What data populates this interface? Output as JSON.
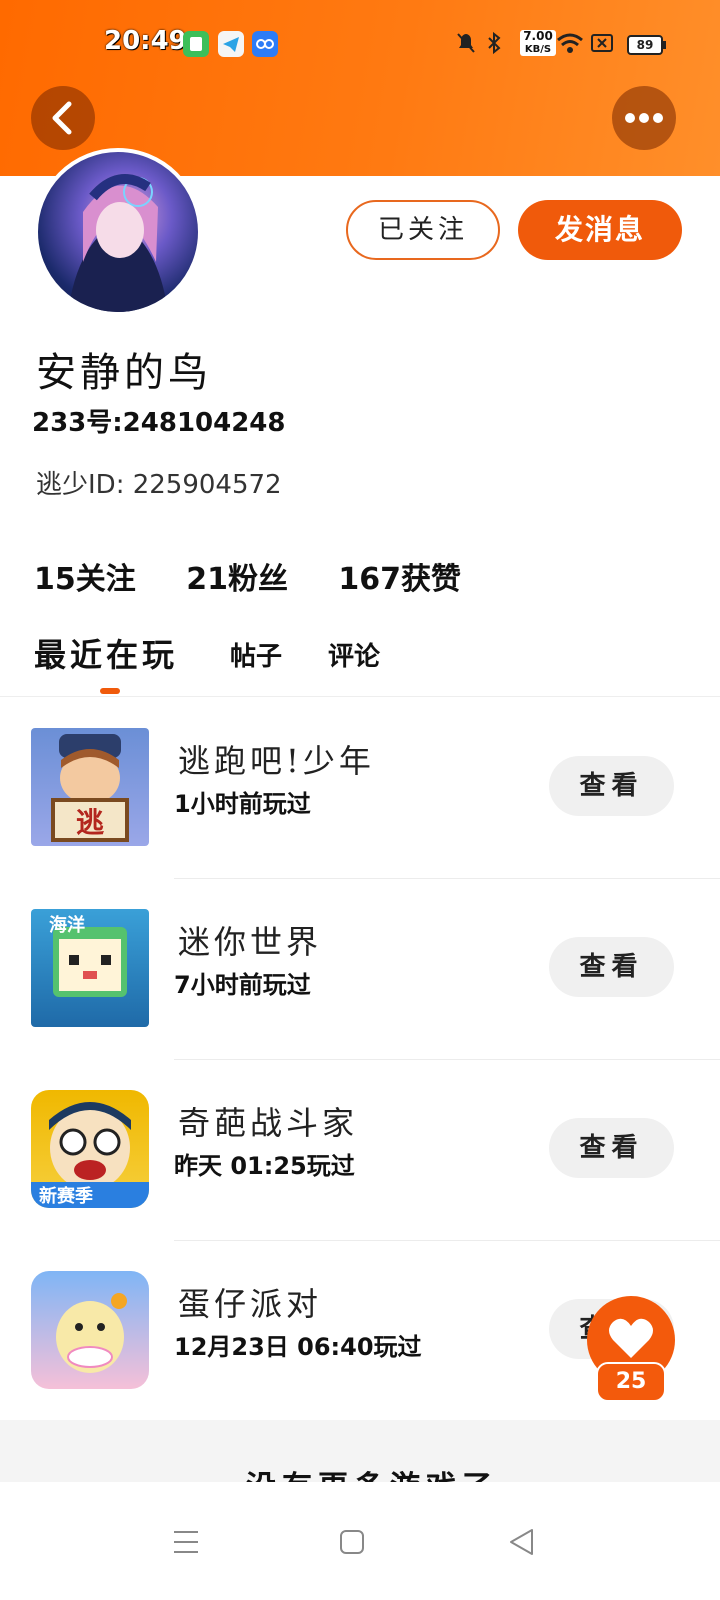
{
  "status_bar": {
    "time": "20:49",
    "speed_value": "7.00",
    "speed_unit": "KB/S",
    "battery": "89"
  },
  "colors": {
    "accent": "#f05a0b",
    "header": "#ff7a12"
  },
  "profile": {
    "username": "安静的鸟",
    "id_233": "233号:248104248",
    "escape_id": "逃少ID: 225904572",
    "follow_button": "已关注",
    "message_button": "发消息"
  },
  "stats": {
    "following": "15关注",
    "fans": "21粉丝",
    "likes": "167获赞"
  },
  "tabs": [
    {
      "label": "最近在玩",
      "active": true
    },
    {
      "label": "帖子",
      "active": false
    },
    {
      "label": "评论",
      "active": false
    }
  ],
  "games": [
    {
      "name": "逃跑吧!少年",
      "played": "1小时前玩过",
      "action": "查看",
      "icon": "escape-game-icon"
    },
    {
      "name": "迷你世界",
      "played": "7小时前玩过",
      "action": "查看",
      "icon": "mini-world-icon"
    },
    {
      "name": "奇葩战斗家",
      "played": "昨天 01:25玩过",
      "action": "查看",
      "icon": "odd-fighter-icon"
    },
    {
      "name": "蛋仔派对",
      "played": "12月23日 06:40玩过",
      "action": "查看",
      "icon": "eggy-party-icon"
    }
  ],
  "like_count": "25",
  "more_games_label": "没有更多游戏了"
}
